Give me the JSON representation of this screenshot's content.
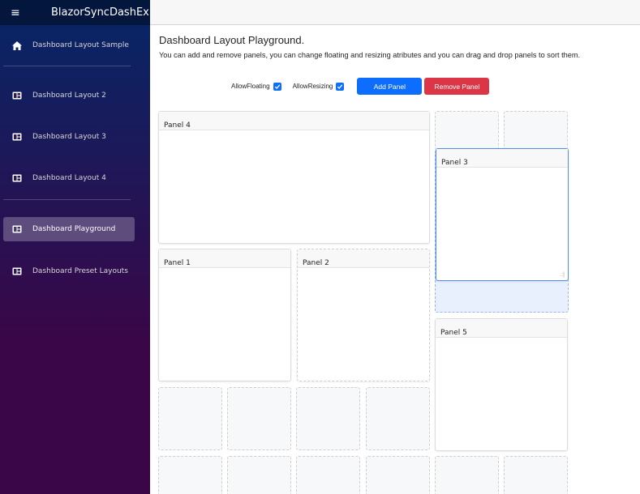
{
  "app": {
    "brand": "BlazorSyncDashEx",
    "menu_icon": "hamburger-icon",
    "menu_glyph": "≡"
  },
  "sidebar": {
    "items": [
      {
        "label": "Dashboard Layout Sample",
        "icon": "home-icon",
        "active": false
      },
      {
        "label": "Dashboard Layout 2",
        "icon": "layout-icon",
        "active": false
      },
      {
        "label": "Dashboard Layout 3",
        "icon": "layout-icon",
        "active": false
      },
      {
        "label": "Dashboard Layout 4",
        "icon": "layout-icon",
        "active": false
      },
      {
        "label": "Dashboard Playground",
        "icon": "layout-icon",
        "active": true
      },
      {
        "label": "Dashboard Preset Layouts",
        "icon": "layout-icon",
        "active": false
      }
    ]
  },
  "main": {
    "title": "Dashboard Layout Playground.",
    "description": "You can add and remove panels, you can change floating and resizing atributes and you can drag and drop panels to sort them.",
    "controls": {
      "allow_floating_label": "AllowFloating",
      "allow_floating_checked": true,
      "allow_resizing_label": "AllowResizing",
      "allow_resizing_checked": true,
      "add_panel_label": "Add Panel",
      "remove_panel_label": "Remove Panel"
    },
    "panels": {
      "panel4": "Panel 4",
      "panel3": "Panel 3",
      "panel1": "Panel 1",
      "panel2": "Panel 2",
      "panel5": "Panel 5"
    }
  },
  "colors": {
    "primary": "#0d6efd",
    "danger": "#dc3545",
    "sidebar_top": "#052767",
    "sidebar_bottom": "#3a0647"
  }
}
